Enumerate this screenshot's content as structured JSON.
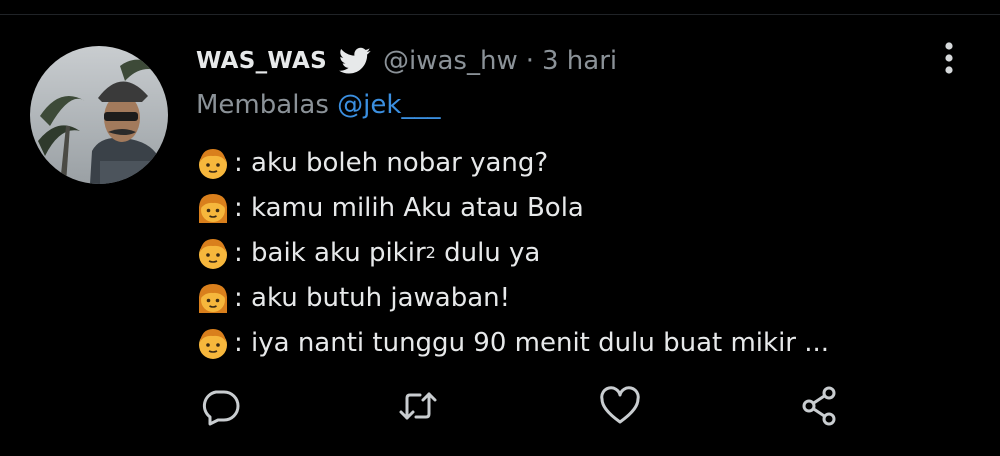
{
  "tweet": {
    "display_name": "WAS_WAS",
    "handle": "@iwas_hw",
    "separator": "·",
    "time": "3 hari",
    "reply_prefix": "Membalas",
    "reply_to": "@jek___",
    "lines": [
      {
        "speaker": "boy",
        "text": ": aku boleh nobar yang?"
      },
      {
        "speaker": "girl",
        "text": ": kamu milih Aku atau Bola"
      },
      {
        "speaker": "boy",
        "text": ": baik aku pikir",
        "sup": "2",
        "after": " dulu ya"
      },
      {
        "speaker": "girl",
        "text": ": aku butuh jawaban!"
      },
      {
        "speaker": "boy",
        "text": ": iya nanti tunggu 90 menit dulu buat mikir ..."
      }
    ]
  },
  "icons": {
    "verified": "bird-icon",
    "more": "more-vertical-icon",
    "actions": [
      "reply-icon",
      "retweet-icon",
      "like-icon",
      "share-icon"
    ]
  },
  "colors": {
    "background": "#000000",
    "text": "#e7e9ea",
    "muted": "#8b9298",
    "mention": "#3b8fe0",
    "emoji_skin": "#f6b73c",
    "emoji_hair": "#d97f1c"
  }
}
